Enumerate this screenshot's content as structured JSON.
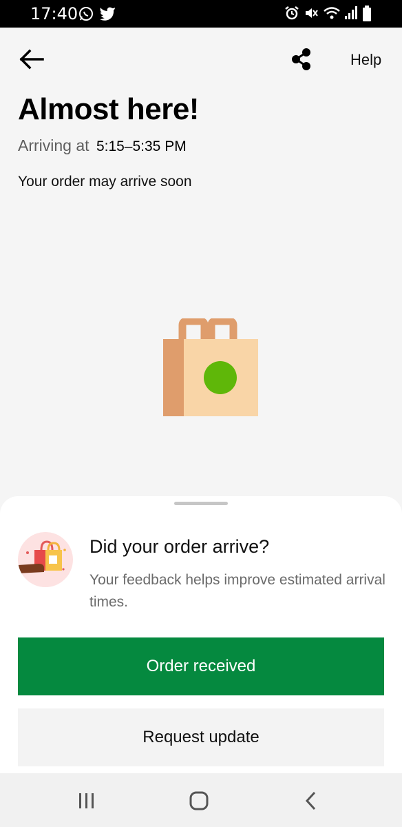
{
  "status_bar": {
    "time": "17:40",
    "left_icons": [
      "whatsapp-icon",
      "twitter-icon"
    ],
    "right_icons": [
      "alarm-icon",
      "mute-icon",
      "wifi-icon",
      "signal-icon",
      "battery-icon"
    ]
  },
  "header": {
    "back_icon": "arrow-left-icon",
    "share_icon": "share-icon",
    "help_label": "Help"
  },
  "order": {
    "title": "Almost here!",
    "arriving_prefix": "Arriving at",
    "arrival_window": "5:15–5:35 PM",
    "note": "Your order may arrive soon"
  },
  "illustration": {
    "icon": "shopping-bag-icon",
    "colors": {
      "bag_front": "#f9d5a7",
      "bag_side": "#df9d6c",
      "dot": "#5fb709"
    }
  },
  "feedback": {
    "question": "Did your order arrive?",
    "subtitle": "Your feedback helps improve estimated arrival times.",
    "primary_button": "Order received",
    "secondary_button": "Request update"
  },
  "colors": {
    "accent": "#05893f"
  },
  "nav_bar": {
    "icons": [
      "recents-icon",
      "home-icon",
      "back-icon"
    ]
  }
}
